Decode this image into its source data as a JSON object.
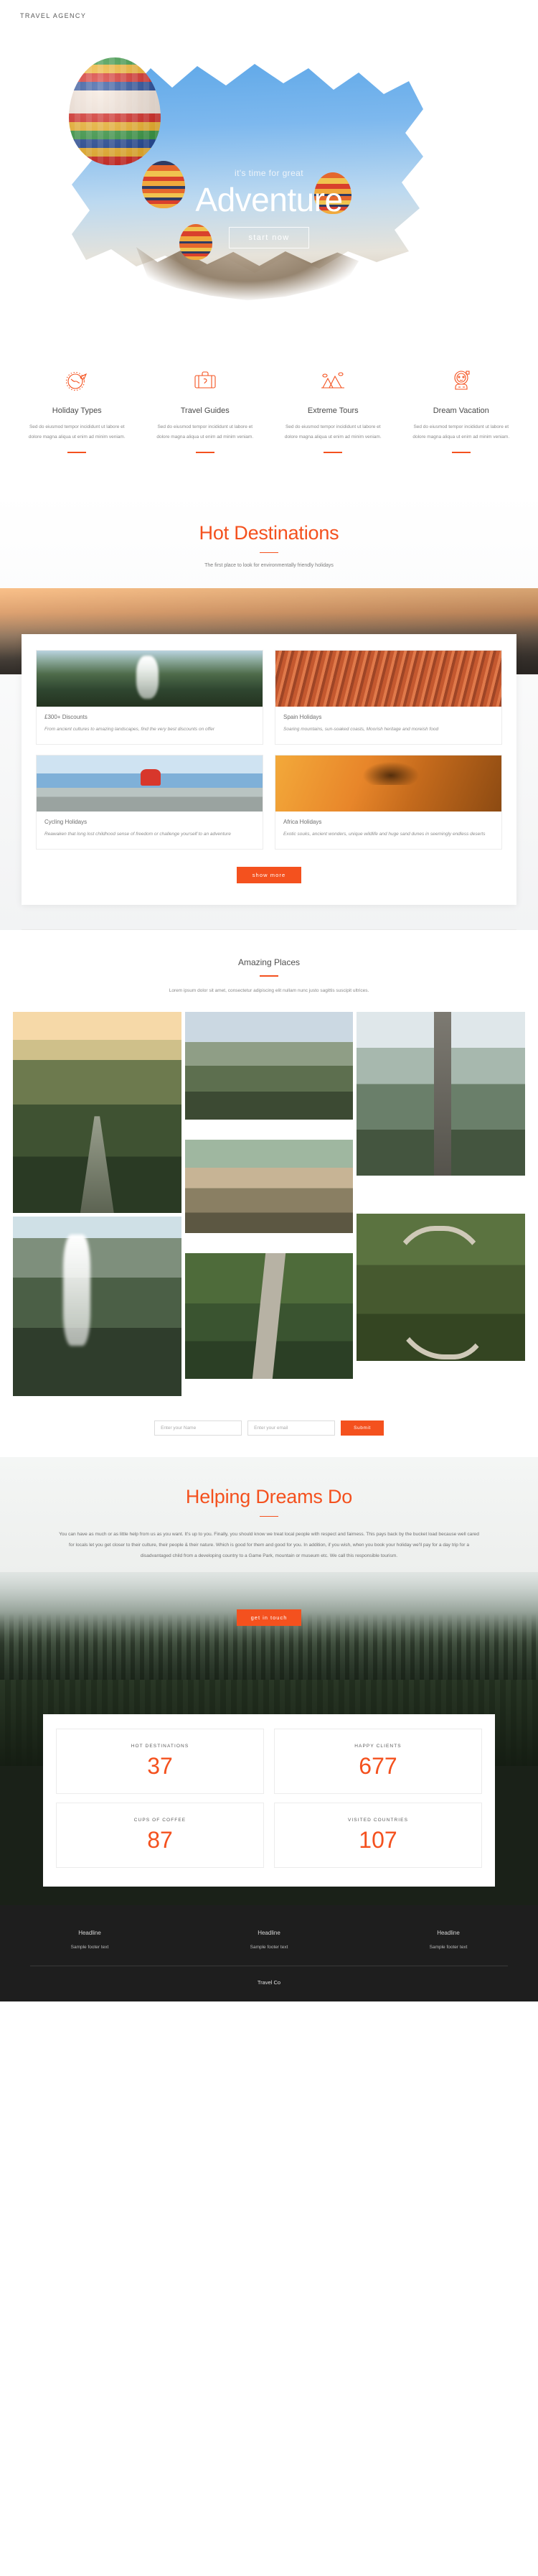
{
  "brand": "TRAVEL AGENCY",
  "hero": {
    "kicker": "it's time for great",
    "title": "Adventure",
    "cta": "start now"
  },
  "features": [
    {
      "icon": "globe-plane-icon",
      "title": "Holiday Types",
      "text": "Sed do eiusmod tempor incididunt ut labore et dolore magna aliqua ut enim ad minim veniam."
    },
    {
      "icon": "suitcase-icon",
      "title": "Travel Guides",
      "text": "Sed do eiusmod tempor incididunt ut labore et dolore magna aliqua ut enim ad minim veniam."
    },
    {
      "icon": "mountains-icon",
      "title": "Extreme Tours",
      "text": "Sed do eiusmod tempor incididunt ut labore et dolore magna aliqua ut enim ad minim veniam."
    },
    {
      "icon": "explorer-person-icon",
      "title": "Dream Vacation",
      "text": "Sed do eiusmod tempor incididunt ut labore et dolore magna aliqua ut enim ad minim veniam."
    }
  ],
  "hot": {
    "title": "Hot Destinations",
    "subtitle": "The first place to look for environmentally friendly holidays",
    "cards": [
      {
        "title": "£300+ Discounts",
        "desc": "From ancient cultures to amazing landscapes, find the very best discounts on offer",
        "image": "aerial-village-photo"
      },
      {
        "title": "Spain Holidays",
        "desc": "Soaring mountains, sun-soaked coasts, Moorish heritage and moreish food",
        "image": "spanish-rooftops-photo"
      },
      {
        "title": "Cycling Holidays",
        "desc": "Reawaken that long lost childhood sense of freedom or challenge yourself to an adventure",
        "image": "cyclist-by-lake-photo"
      },
      {
        "title": "Africa Holidays",
        "desc": "Exotic souks, ancient wonders, unique wildlife and huge sand dunes in seemingly endless deserts",
        "image": "camels-desert-photo"
      }
    ],
    "show_more": "show more"
  },
  "amazing": {
    "title": "Amazing Places",
    "subtitle": "Lorem ipsum dolor sit amet, consectetur adipiscing elit nullam nunc justo sagittis suscipit ultrices.",
    "photos": [
      "forest-road-sunrise-photo",
      "mountain-ridge-photo",
      "misty-highway-photo",
      "hillside-village-photo",
      "waterfall-canyon-photo",
      "green-road-aerial-photo",
      "winding-road-forest-photo"
    ]
  },
  "newsletter": {
    "name_placeholder": "Enter your Name",
    "email_placeholder": "Enter your email",
    "submit": "Submit"
  },
  "dreams": {
    "title": "Helping Dreams Do",
    "body": "You can have as much or as little help from us as you want. It's up to you. Finally, you should know we treat local people with respect and fairness. This pays back by the bucket load because well cared for locals let you get closer to their culture, their people & their nature. Which is good for them and good for you. In addition, if you wish, when you book your holiday we'll pay for a day trip for a disadvantaged child from a developing country to a Game Park, mountain or museum etc. We call this responsible tourism.",
    "cta": "get in touch"
  },
  "stats": [
    {
      "label": "HOT DESTINATIONS",
      "value": "37"
    },
    {
      "label": "HAPPY CLIENTS",
      "value": "677"
    },
    {
      "label": "CUPS OF COFFEE",
      "value": "87"
    },
    {
      "label": "VISITED COUNTRIES",
      "value": "107"
    }
  ],
  "footer": {
    "columns": [
      {
        "head": "Headline",
        "text": "Sample footer text"
      },
      {
        "head": "Headline",
        "text": "Sample footer text"
      },
      {
        "head": "Headline",
        "text": "Sample footer text"
      }
    ],
    "copyright": "Travel Co"
  },
  "colors": {
    "accent": "#f4511e",
    "footer_bg": "#1e1e1e"
  }
}
